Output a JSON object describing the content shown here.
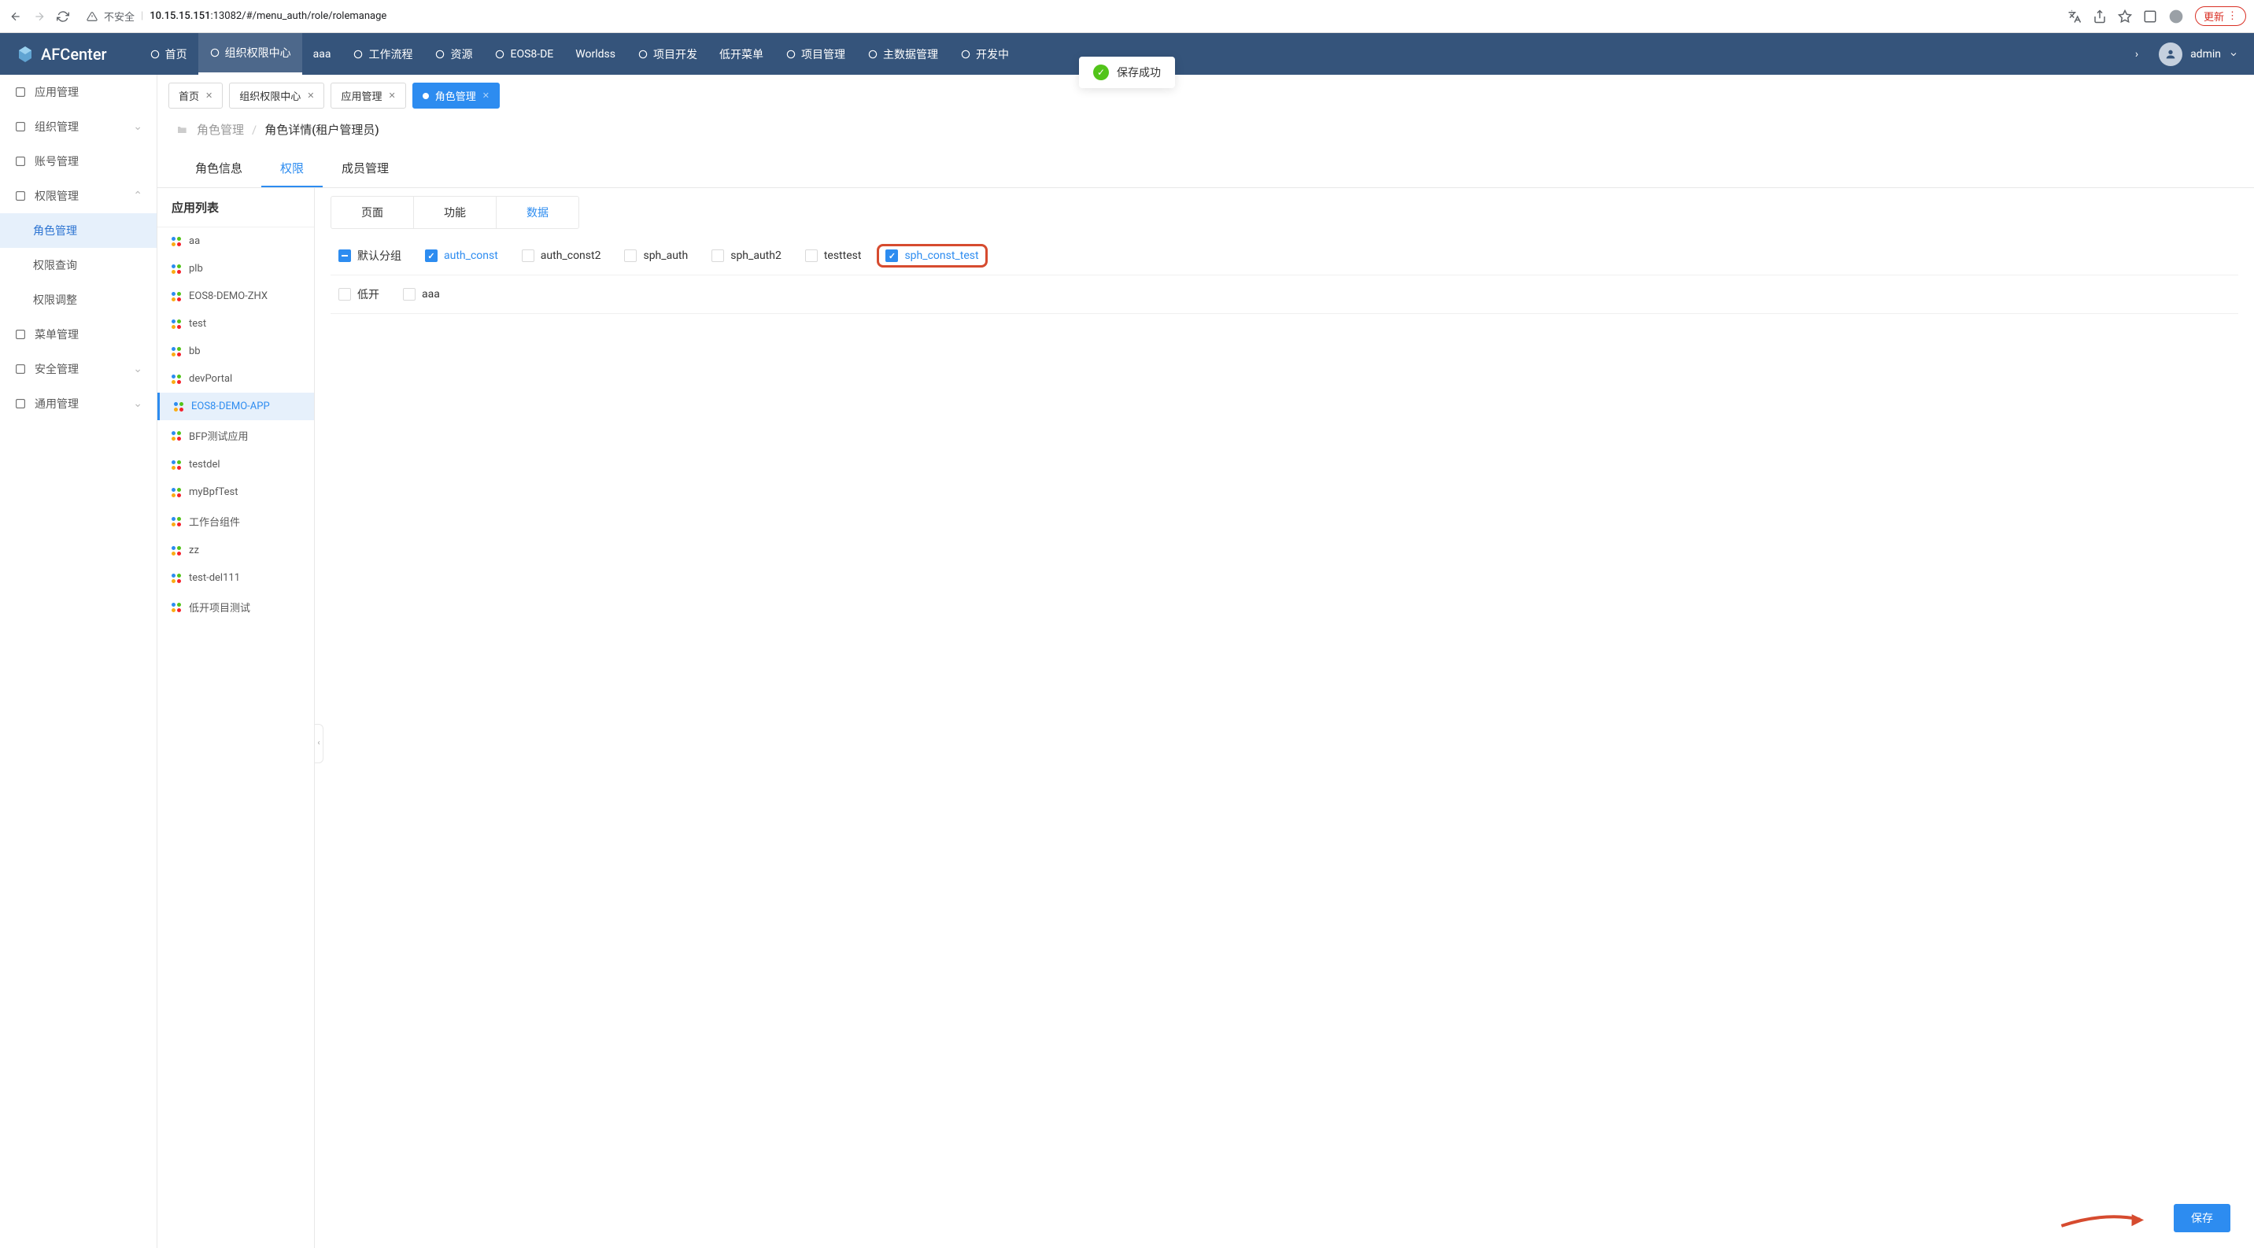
{
  "browser": {
    "insecure_label": "不安全",
    "url_host": "10.15.15.151",
    "url_port": ":13082",
    "url_path": "/#/menu_auth/role/rolemanage",
    "update_label": "更新"
  },
  "header": {
    "logo_text": "AFCenter",
    "nav": [
      {
        "label": "首页",
        "icon": "diamond"
      },
      {
        "label": "组织权限中心",
        "icon": "target",
        "active": true
      },
      {
        "label": "aaa",
        "icon": ""
      },
      {
        "label": "工作流程",
        "icon": "flow"
      },
      {
        "label": "资源",
        "icon": "heart"
      },
      {
        "label": "EOS8-DE",
        "icon": "stack"
      },
      {
        "label": "Worldss",
        "icon": ""
      },
      {
        "label": "项目开发",
        "icon": "diamond"
      },
      {
        "label": "低开菜单",
        "icon": ""
      },
      {
        "label": "项目管理",
        "icon": "stack"
      },
      {
        "label": "主数据管理",
        "icon": "settings"
      },
      {
        "label": "开发中",
        "icon": "new"
      }
    ],
    "user_name": "admin"
  },
  "toast": {
    "message": "保存成功"
  },
  "sidebar": {
    "items": [
      {
        "label": "应用管理",
        "icon": "app"
      },
      {
        "label": "组织管理",
        "icon": "org",
        "arrow": "down"
      },
      {
        "label": "账号管理",
        "icon": "user"
      },
      {
        "label": "权限管理",
        "icon": "key",
        "arrow": "up",
        "expanded": true,
        "children": [
          {
            "label": "角色管理",
            "active": true
          },
          {
            "label": "权限查询"
          },
          {
            "label": "权限调整"
          }
        ]
      },
      {
        "label": "菜单管理",
        "icon": "menu"
      },
      {
        "label": "安全管理",
        "icon": "shield",
        "arrow": "down"
      },
      {
        "label": "通用管理",
        "icon": "gear",
        "arrow": "down"
      }
    ]
  },
  "tabs": [
    {
      "label": "首页"
    },
    {
      "label": "组织权限中心"
    },
    {
      "label": "应用管理"
    },
    {
      "label": "角色管理",
      "active": true
    }
  ],
  "breadcrumb": {
    "parent": "角色管理",
    "current": "角色详情(租户管理员)"
  },
  "sub_tabs": [
    {
      "label": "角色信息"
    },
    {
      "label": "权限",
      "active": true
    },
    {
      "label": "成员管理"
    }
  ],
  "app_list": {
    "header": "应用列表",
    "items": [
      {
        "label": "aa"
      },
      {
        "label": "plb"
      },
      {
        "label": "EOS8-DEMO-ZHX"
      },
      {
        "label": "test"
      },
      {
        "label": "bb"
      },
      {
        "label": "devPortal"
      },
      {
        "label": "EOS8-DEMO-APP",
        "active": true
      },
      {
        "label": "BFP测试应用"
      },
      {
        "label": "testdel"
      },
      {
        "label": "myBpfTest"
      },
      {
        "label": "工作台组件"
      },
      {
        "label": "zz"
      },
      {
        "label": "test-del111"
      },
      {
        "label": "低开项目测试"
      }
    ]
  },
  "perm_type_tabs": [
    {
      "label": "页面"
    },
    {
      "label": "功能"
    },
    {
      "label": "数据",
      "active": true
    }
  ],
  "perm_rows": [
    {
      "group_state": "indeterminate",
      "group_label": "默认分组",
      "items": [
        {
          "label": "auth_const",
          "checked": true
        },
        {
          "label": "auth_const2",
          "checked": false
        },
        {
          "label": "sph_auth",
          "checked": false
        },
        {
          "label": "sph_auth2",
          "checked": false
        },
        {
          "label": "testtest",
          "checked": false
        },
        {
          "label": "sph_const_test",
          "checked": true,
          "highlight": true
        }
      ]
    },
    {
      "group_state": "unchecked",
      "group_label": "低开",
      "items": [
        {
          "label": "aaa",
          "checked": false
        }
      ]
    }
  ],
  "save_label": "保存"
}
